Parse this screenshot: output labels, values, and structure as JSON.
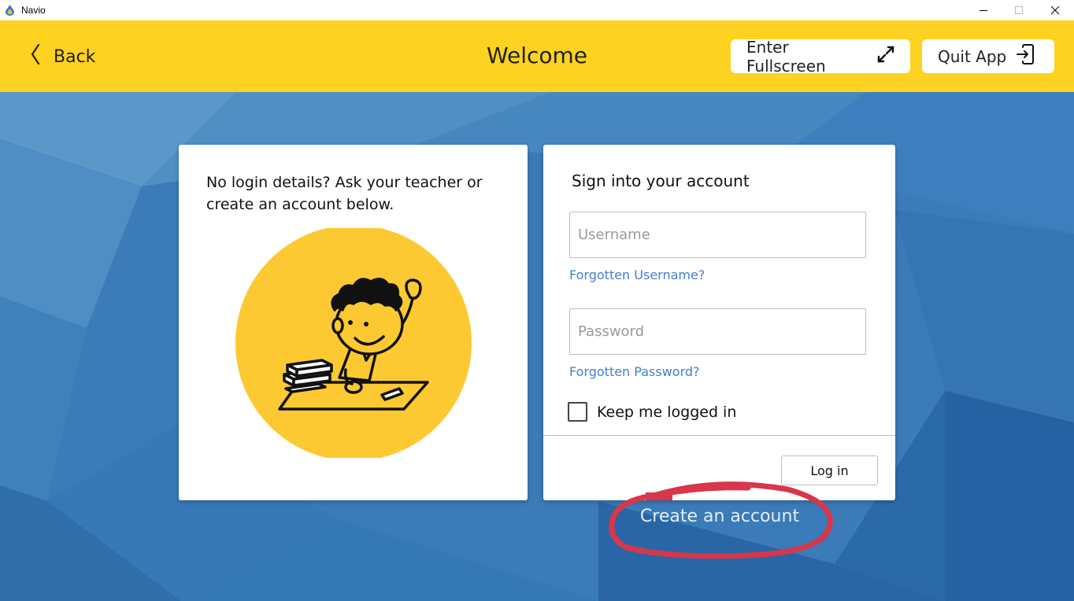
{
  "window": {
    "title": "Navio",
    "icons": {
      "app": "navio-drop-icon",
      "minimize": "minimize-icon",
      "maximize": "maximize-icon",
      "close": "close-icon"
    }
  },
  "header": {
    "back_label": "Back",
    "title": "Welcome",
    "fullscreen_label": "Enter Fullscreen",
    "quit_label": "Quit App",
    "icons": {
      "back": "chevron-left-icon",
      "fullscreen": "expand-arrows-icon",
      "quit": "exit-door-icon"
    }
  },
  "info_card": {
    "message": "No login details? Ask your teacher or create an account below."
  },
  "signin_card": {
    "title": "Sign into your account",
    "username": {
      "value": "",
      "placeholder": "Username"
    },
    "forgot_username": "Forgotten Username?",
    "password": {
      "value": "",
      "placeholder": "Password"
    },
    "forgot_password": "Forgotten Password?",
    "keep_logged_in": {
      "label": "Keep me logged in",
      "checked": false
    },
    "login_label": "Log in"
  },
  "create_account": "Create an account",
  "colors": {
    "header_yellow": "#fdd220",
    "background_blue": "#2f6fae",
    "link_blue": "#3f7fd0",
    "highlight_red": "#d8364a"
  }
}
